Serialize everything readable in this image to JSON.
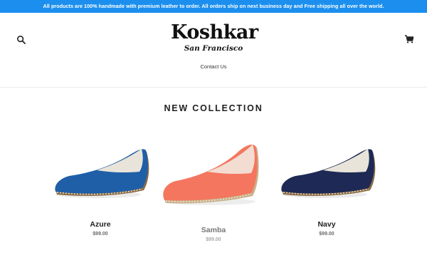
{
  "announcement": {
    "text": "All products are 100% handmade with premium leather to order. All orders ship on next business day and Free shipping all over the world."
  },
  "header": {
    "logo_main": "Koshkar",
    "logo_sub": "San Francisco",
    "search_icon": "search-icon",
    "cart_icon": "cart-icon",
    "nav": [
      {
        "label": "Contact Us"
      }
    ]
  },
  "collection": {
    "title": "NEW COLLECTION",
    "products": [
      {
        "name": "Azure",
        "price": "$99.00",
        "color": "#1f5fa8"
      },
      {
        "name": "Samba",
        "price": "$99.00",
        "color": "#f4765f"
      },
      {
        "name": "Navy",
        "price": "$99.00",
        "color": "#1e2a55"
      }
    ]
  },
  "colors": {
    "accent": "#1c8fee"
  }
}
